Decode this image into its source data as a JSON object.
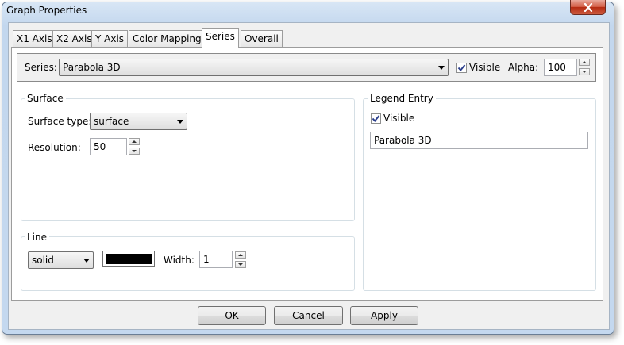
{
  "window": {
    "title": "Graph Properties"
  },
  "tabs": [
    "X1 Axis",
    "X2 Axis",
    "Y Axis",
    "Color Mapping",
    "Series",
    "Overall"
  ],
  "active_tab": "Series",
  "series": {
    "label": "Series:",
    "selected": "Parabola 3D",
    "visible_label": "Visible",
    "visible_checked": true,
    "alpha_label": "Alpha:",
    "alpha_value": "100"
  },
  "surface": {
    "title": "Surface",
    "type_label": "Surface type:",
    "type_value": "surface",
    "resolution_label": "Resolution:",
    "resolution_value": "50"
  },
  "legend": {
    "title": "Legend Entry",
    "visible_label": "Visible",
    "visible_checked": true,
    "text_value": "Parabola 3D"
  },
  "line": {
    "title": "Line",
    "style_value": "solid",
    "color": "#000000",
    "width_label": "Width:",
    "width_value": "1"
  },
  "buttons": {
    "ok": "OK",
    "cancel": "Cancel",
    "apply": "Apply"
  }
}
